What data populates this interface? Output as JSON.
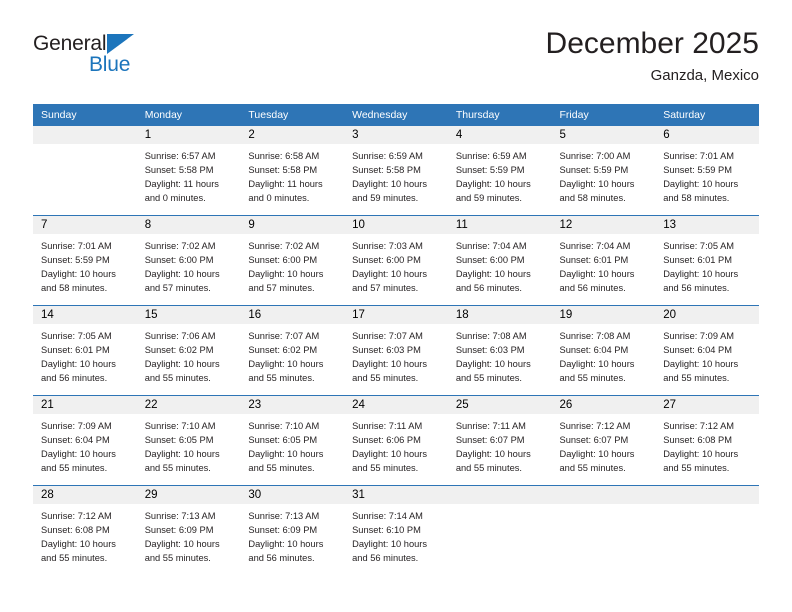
{
  "brand": {
    "name_part1": "General",
    "name_part2": "Blue",
    "accent_color": "#1c75bc",
    "triangle_icon": "triangle-icon"
  },
  "header": {
    "title": "December 2025",
    "subtitle": "Ganzda, Mexico"
  },
  "theme": {
    "header_row_bg": "#2e75b6",
    "day_number_bg": "#f0f0f0",
    "text_color": "#231f20"
  },
  "calendar": {
    "day_headers": [
      "Sunday",
      "Monday",
      "Tuesday",
      "Wednesday",
      "Thursday",
      "Friday",
      "Saturday"
    ],
    "weeks": [
      [
        {
          "day": "",
          "sunrise": "",
          "sunset": "",
          "daylight1": "",
          "daylight2": ""
        },
        {
          "day": "1",
          "sunrise": "Sunrise: 6:57 AM",
          "sunset": "Sunset: 5:58 PM",
          "daylight1": "Daylight: 11 hours",
          "daylight2": "and 0 minutes."
        },
        {
          "day": "2",
          "sunrise": "Sunrise: 6:58 AM",
          "sunset": "Sunset: 5:58 PM",
          "daylight1": "Daylight: 11 hours",
          "daylight2": "and 0 minutes."
        },
        {
          "day": "3",
          "sunrise": "Sunrise: 6:59 AM",
          "sunset": "Sunset: 5:58 PM",
          "daylight1": "Daylight: 10 hours",
          "daylight2": "and 59 minutes."
        },
        {
          "day": "4",
          "sunrise": "Sunrise: 6:59 AM",
          "sunset": "Sunset: 5:59 PM",
          "daylight1": "Daylight: 10 hours",
          "daylight2": "and 59 minutes."
        },
        {
          "day": "5",
          "sunrise": "Sunrise: 7:00 AM",
          "sunset": "Sunset: 5:59 PM",
          "daylight1": "Daylight: 10 hours",
          "daylight2": "and 58 minutes."
        },
        {
          "day": "6",
          "sunrise": "Sunrise: 7:01 AM",
          "sunset": "Sunset: 5:59 PM",
          "daylight1": "Daylight: 10 hours",
          "daylight2": "and 58 minutes."
        }
      ],
      [
        {
          "day": "7",
          "sunrise": "Sunrise: 7:01 AM",
          "sunset": "Sunset: 5:59 PM",
          "daylight1": "Daylight: 10 hours",
          "daylight2": "and 58 minutes."
        },
        {
          "day": "8",
          "sunrise": "Sunrise: 7:02 AM",
          "sunset": "Sunset: 6:00 PM",
          "daylight1": "Daylight: 10 hours",
          "daylight2": "and 57 minutes."
        },
        {
          "day": "9",
          "sunrise": "Sunrise: 7:02 AM",
          "sunset": "Sunset: 6:00 PM",
          "daylight1": "Daylight: 10 hours",
          "daylight2": "and 57 minutes."
        },
        {
          "day": "10",
          "sunrise": "Sunrise: 7:03 AM",
          "sunset": "Sunset: 6:00 PM",
          "daylight1": "Daylight: 10 hours",
          "daylight2": "and 57 minutes."
        },
        {
          "day": "11",
          "sunrise": "Sunrise: 7:04 AM",
          "sunset": "Sunset: 6:00 PM",
          "daylight1": "Daylight: 10 hours",
          "daylight2": "and 56 minutes."
        },
        {
          "day": "12",
          "sunrise": "Sunrise: 7:04 AM",
          "sunset": "Sunset: 6:01 PM",
          "daylight1": "Daylight: 10 hours",
          "daylight2": "and 56 minutes."
        },
        {
          "day": "13",
          "sunrise": "Sunrise: 7:05 AM",
          "sunset": "Sunset: 6:01 PM",
          "daylight1": "Daylight: 10 hours",
          "daylight2": "and 56 minutes."
        }
      ],
      [
        {
          "day": "14",
          "sunrise": "Sunrise: 7:05 AM",
          "sunset": "Sunset: 6:01 PM",
          "daylight1": "Daylight: 10 hours",
          "daylight2": "and 56 minutes."
        },
        {
          "day": "15",
          "sunrise": "Sunrise: 7:06 AM",
          "sunset": "Sunset: 6:02 PM",
          "daylight1": "Daylight: 10 hours",
          "daylight2": "and 55 minutes."
        },
        {
          "day": "16",
          "sunrise": "Sunrise: 7:07 AM",
          "sunset": "Sunset: 6:02 PM",
          "daylight1": "Daylight: 10 hours",
          "daylight2": "and 55 minutes."
        },
        {
          "day": "17",
          "sunrise": "Sunrise: 7:07 AM",
          "sunset": "Sunset: 6:03 PM",
          "daylight1": "Daylight: 10 hours",
          "daylight2": "and 55 minutes."
        },
        {
          "day": "18",
          "sunrise": "Sunrise: 7:08 AM",
          "sunset": "Sunset: 6:03 PM",
          "daylight1": "Daylight: 10 hours",
          "daylight2": "and 55 minutes."
        },
        {
          "day": "19",
          "sunrise": "Sunrise: 7:08 AM",
          "sunset": "Sunset: 6:04 PM",
          "daylight1": "Daylight: 10 hours",
          "daylight2": "and 55 minutes."
        },
        {
          "day": "20",
          "sunrise": "Sunrise: 7:09 AM",
          "sunset": "Sunset: 6:04 PM",
          "daylight1": "Daylight: 10 hours",
          "daylight2": "and 55 minutes."
        }
      ],
      [
        {
          "day": "21",
          "sunrise": "Sunrise: 7:09 AM",
          "sunset": "Sunset: 6:04 PM",
          "daylight1": "Daylight: 10 hours",
          "daylight2": "and 55 minutes."
        },
        {
          "day": "22",
          "sunrise": "Sunrise: 7:10 AM",
          "sunset": "Sunset: 6:05 PM",
          "daylight1": "Daylight: 10 hours",
          "daylight2": "and 55 minutes."
        },
        {
          "day": "23",
          "sunrise": "Sunrise: 7:10 AM",
          "sunset": "Sunset: 6:05 PM",
          "daylight1": "Daylight: 10 hours",
          "daylight2": "and 55 minutes."
        },
        {
          "day": "24",
          "sunrise": "Sunrise: 7:11 AM",
          "sunset": "Sunset: 6:06 PM",
          "daylight1": "Daylight: 10 hours",
          "daylight2": "and 55 minutes."
        },
        {
          "day": "25",
          "sunrise": "Sunrise: 7:11 AM",
          "sunset": "Sunset: 6:07 PM",
          "daylight1": "Daylight: 10 hours",
          "daylight2": "and 55 minutes."
        },
        {
          "day": "26",
          "sunrise": "Sunrise: 7:12 AM",
          "sunset": "Sunset: 6:07 PM",
          "daylight1": "Daylight: 10 hours",
          "daylight2": "and 55 minutes."
        },
        {
          "day": "27",
          "sunrise": "Sunrise: 7:12 AM",
          "sunset": "Sunset: 6:08 PM",
          "daylight1": "Daylight: 10 hours",
          "daylight2": "and 55 minutes."
        }
      ],
      [
        {
          "day": "28",
          "sunrise": "Sunrise: 7:12 AM",
          "sunset": "Sunset: 6:08 PM",
          "daylight1": "Daylight: 10 hours",
          "daylight2": "and 55 minutes."
        },
        {
          "day": "29",
          "sunrise": "Sunrise: 7:13 AM",
          "sunset": "Sunset: 6:09 PM",
          "daylight1": "Daylight: 10 hours",
          "daylight2": "and 55 minutes."
        },
        {
          "day": "30",
          "sunrise": "Sunrise: 7:13 AM",
          "sunset": "Sunset: 6:09 PM",
          "daylight1": "Daylight: 10 hours",
          "daylight2": "and 56 minutes."
        },
        {
          "day": "31",
          "sunrise": "Sunrise: 7:14 AM",
          "sunset": "Sunset: 6:10 PM",
          "daylight1": "Daylight: 10 hours",
          "daylight2": "and 56 minutes."
        },
        {
          "day": "",
          "sunrise": "",
          "sunset": "",
          "daylight1": "",
          "daylight2": ""
        },
        {
          "day": "",
          "sunrise": "",
          "sunset": "",
          "daylight1": "",
          "daylight2": ""
        },
        {
          "day": "",
          "sunrise": "",
          "sunset": "",
          "daylight1": "",
          "daylight2": ""
        }
      ]
    ]
  }
}
